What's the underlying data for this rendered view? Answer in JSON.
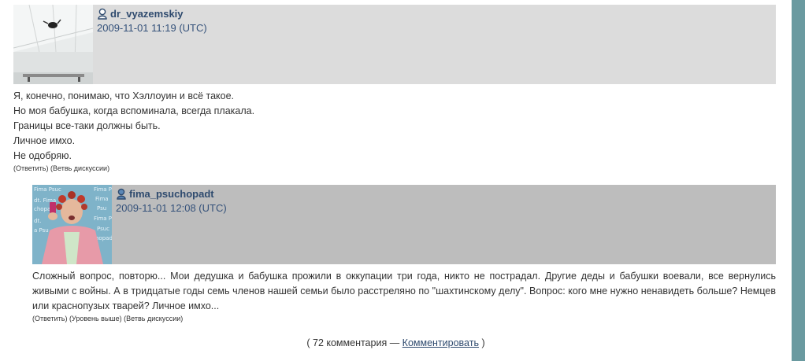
{
  "comments": [
    {
      "username": "dr_vyazemskiy",
      "datetime": "2009-11-01 11:19 (UTC)",
      "lines": [
        "Я, конечно, понимаю, что Хэллоуин и всё такое.",
        "Но моя бабушка, когда вспоминала, всегда плакала.",
        "Границы все-таки должны быть.",
        "Личное имхо.",
        "Не одобряю."
      ],
      "actions": {
        "reply": "Ответить",
        "thread": "Ветвь дискуссии"
      }
    },
    {
      "username": "fima_psuchopadt",
      "datetime": "2009-11-01 12:08 (UTC)",
      "lines": [
        "Сложный вопрос, повторю... Мои дедушка и бабушка прожили в оккупации три года, никто не пострадал. Другие деды и бабушки воевали, все вернулись живыми с войны. А в тридцатые годы семь членов нашей семьи было расстреляно по \"шахтинскому делу\". Вопрос: кого мне нужно ненавидеть больше? Немцев или краснопузых тварей? Личное имхо..."
      ],
      "actions": {
        "reply": "Ответить",
        "parent": "Уровень выше",
        "thread": "Ветвь дискуссии"
      },
      "avatar_text": [
        "Fima Psuc",
        "dt. Fima",
        "chopadt",
        "Fima Ps",
        "Fima",
        "Psu",
        "dt.",
        "Fima Psuc",
        "a Psu",
        "Psuc",
        "hopadt"
      ]
    }
  ],
  "footer": {
    "open": "( 72 комментария — ",
    "link": "Комментировать",
    "close": " )"
  },
  "colors": {
    "header1": "#dcdcdc",
    "header2": "#bdbdbd",
    "link": "#2e4a6e",
    "sidebar": "#6a9aa0"
  }
}
